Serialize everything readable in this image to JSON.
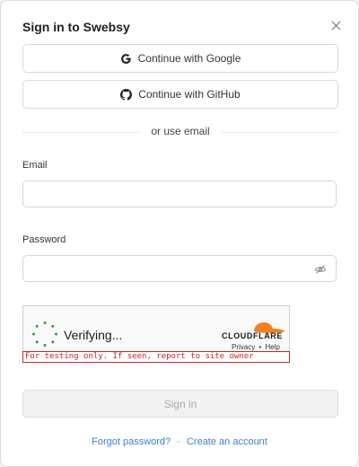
{
  "modal": {
    "title": "Sign in to Swebsy"
  },
  "oauth": {
    "google_label": "Continue with Google",
    "github_label": "Continue with GitHub"
  },
  "divider": {
    "text": "or use email"
  },
  "form": {
    "email_label": "Email",
    "email_value": "",
    "password_label": "Password",
    "password_value": ""
  },
  "captcha": {
    "status": "Verifying...",
    "brand": "CLOUDFLARE",
    "privacy": "Privacy",
    "separator": "•",
    "help": "Help",
    "test_note": "For testing only. If seen, report to site owner"
  },
  "submit": {
    "label": "Sign in"
  },
  "footer": {
    "forgot": "Forgot password?",
    "separator": "·",
    "create": "Create an account"
  },
  "icons": {
    "close": "close-icon",
    "google": "google-icon",
    "github": "github-icon",
    "eye": "eye-slash-icon",
    "spinner": "spinner-icon",
    "cloudflare": "cloudflare-cloud-icon"
  },
  "colors": {
    "link": "#3d7ecf",
    "test_note": "#c62828",
    "cloudflare_orange": "#f38020",
    "cloudflare_light": "#fbad41",
    "spinner": "#2f9e44"
  }
}
